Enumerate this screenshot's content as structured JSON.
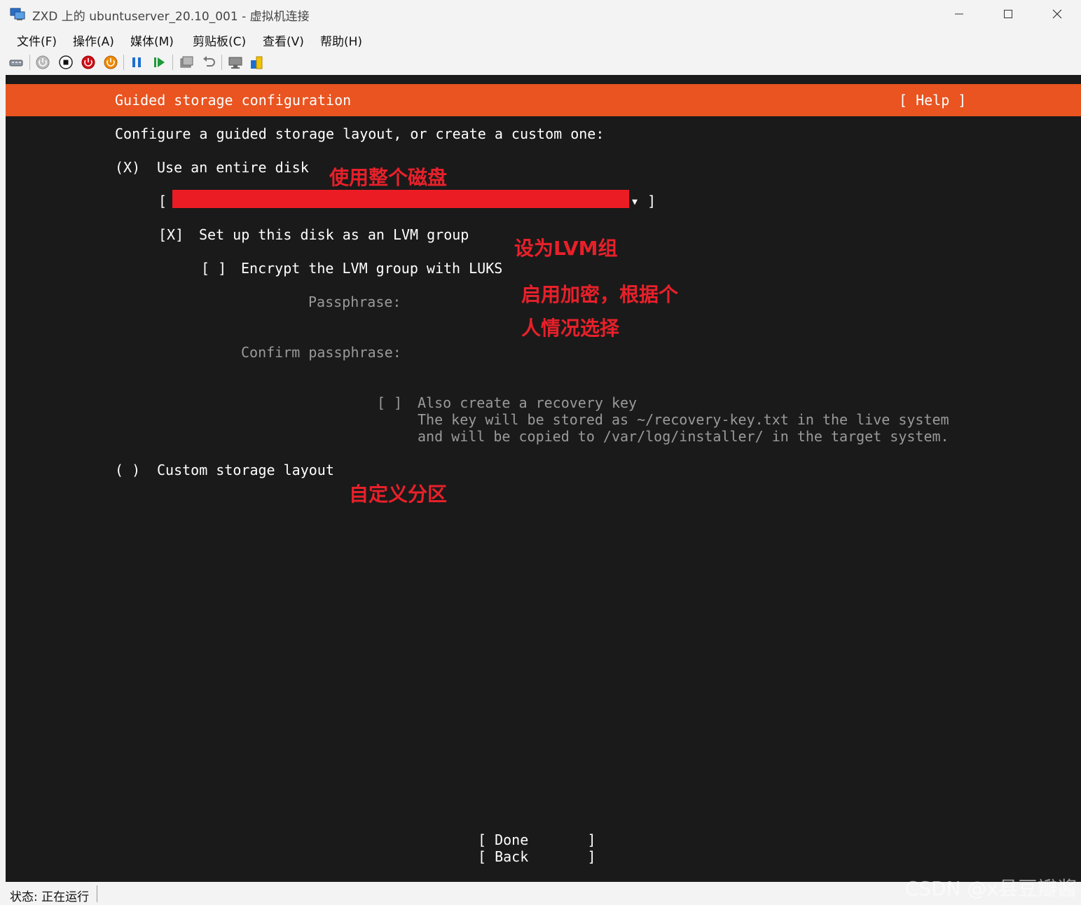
{
  "window": {
    "title": "ZXD 上的 ubuntuserver_20.10_001 - 虚拟机连接"
  },
  "menu": [
    "文件(F)",
    "操作(A)",
    "媒体(M)",
    "剪贴板(C)",
    "查看(V)",
    "帮助(H)"
  ],
  "toolbar": {
    "icons": [
      "ctrl-alt-del-icon",
      "start-icon",
      "turn-off-icon",
      "shutdown-icon",
      "save-icon",
      "pause-icon",
      "reset-icon",
      "checkpoint-icon",
      "revert-icon",
      "enhanced-session-icon",
      "share-icon"
    ]
  },
  "installer": {
    "header_title": "Guided storage configuration",
    "help_label": "[ Help ]",
    "prompt": "Configure a guided storage layout, or create a custom one:",
    "entire_disk_radio": "(X)",
    "entire_disk_label": "Use an entire disk",
    "disk_select_left": "[",
    "disk_select_right": "▾ ]",
    "lvm_checkbox": "[X]",
    "lvm_label": "Set up this disk as an LVM group",
    "encrypt_checkbox": "[ ]",
    "encrypt_label": "Encrypt the LVM group with LUKS",
    "passphrase_label": "Passphrase:",
    "confirm_passphrase_label": "Confirm passphrase:",
    "recovery_checkbox": "[ ]",
    "recovery_label": "Also create a recovery key",
    "recovery_help_line1": "The key will be stored as ~/recovery-key.txt in the live system",
    "recovery_help_line2": "and will be copied to /var/log/installer/ in the target system.",
    "custom_radio": "( )",
    "custom_label": "Custom storage layout",
    "done_button": "[ Done       ]",
    "back_button": "[ Back       ]"
  },
  "annotations": {
    "entire_disk": "使用整个磁盘",
    "lvm": "设为LVM组",
    "encrypt_line1": "启用加密，根据个",
    "encrypt_line2": "人情况选择",
    "custom": "自定义分区"
  },
  "status": {
    "text": "状态: 正在运行"
  },
  "watermark": "CSDN @x县豆瓣酱",
  "colors": {
    "header_orange": "#e95420",
    "terminal_bg": "#1a1a1a",
    "annotation_red": "#e8202a",
    "redaction_red": "#ec1c24"
  }
}
